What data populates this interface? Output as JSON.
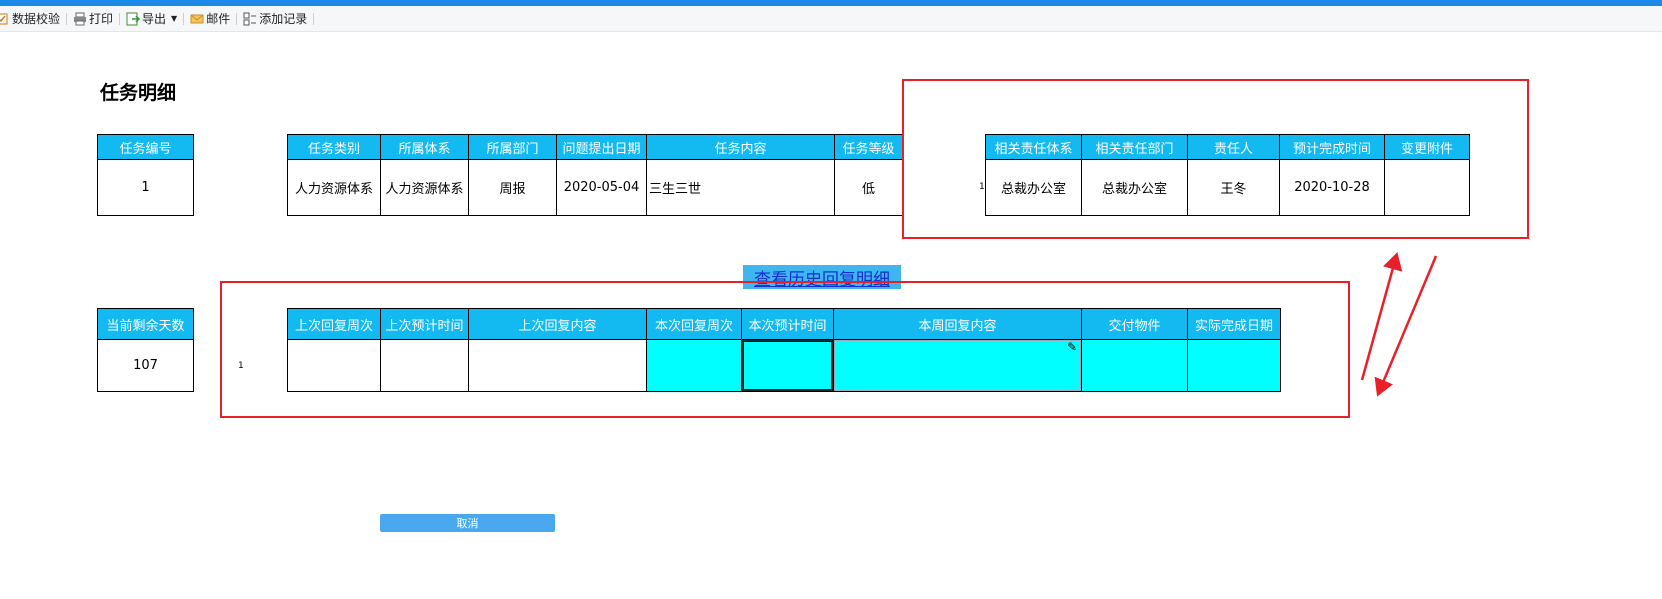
{
  "toolbar": {
    "items": [
      {
        "label": "数据校验",
        "icon": "check-data-icon"
      },
      {
        "label": "打印",
        "icon": "printer-icon"
      },
      {
        "label": "导出",
        "icon": "export-icon"
      },
      {
        "label": "邮件",
        "icon": "mail-icon"
      },
      {
        "label": "添加记录",
        "icon": "add-record-icon"
      }
    ]
  },
  "page": {
    "title": "任务明细"
  },
  "task_no": {
    "header": "任务编号",
    "value": "1"
  },
  "task_info": {
    "headers": [
      "任务类别",
      "所属体系",
      "所属部门",
      "问题提出日期",
      "任务内容",
      "任务等级"
    ],
    "row": [
      "人力资源体系",
      "人力资源体系",
      "周报",
      "2020-05-04",
      "三生三世",
      "低"
    ]
  },
  "responsibility": {
    "row_number": "1",
    "headers": [
      "相关责任体系",
      "相关责任部门",
      "责任人",
      "预计完成时间",
      "变更附件"
    ],
    "row": [
      "总裁办公室",
      "总裁办公室",
      "王冬",
      "2020-10-28",
      ""
    ]
  },
  "history_link": "查看历史回复明细",
  "remaining_days": {
    "header": "当前剩余天数",
    "value": "107"
  },
  "reply": {
    "row_number": "1",
    "headers": [
      "上次回复周次",
      "上次预计时间",
      "上次回复内容",
      "本次回复周次",
      "本次预计时间",
      "本周回复内容",
      "交付物件",
      "实际完成日期"
    ],
    "row": [
      "",
      "",
      "",
      "",
      "",
      "",
      "",
      ""
    ]
  },
  "buttons": {
    "cancel": "取消"
  },
  "colors": {
    "header_bg": "#13b9f1",
    "input_cell": "#00ffff",
    "annotation": "#e8202a",
    "topbar": "#1a8ae6"
  }
}
